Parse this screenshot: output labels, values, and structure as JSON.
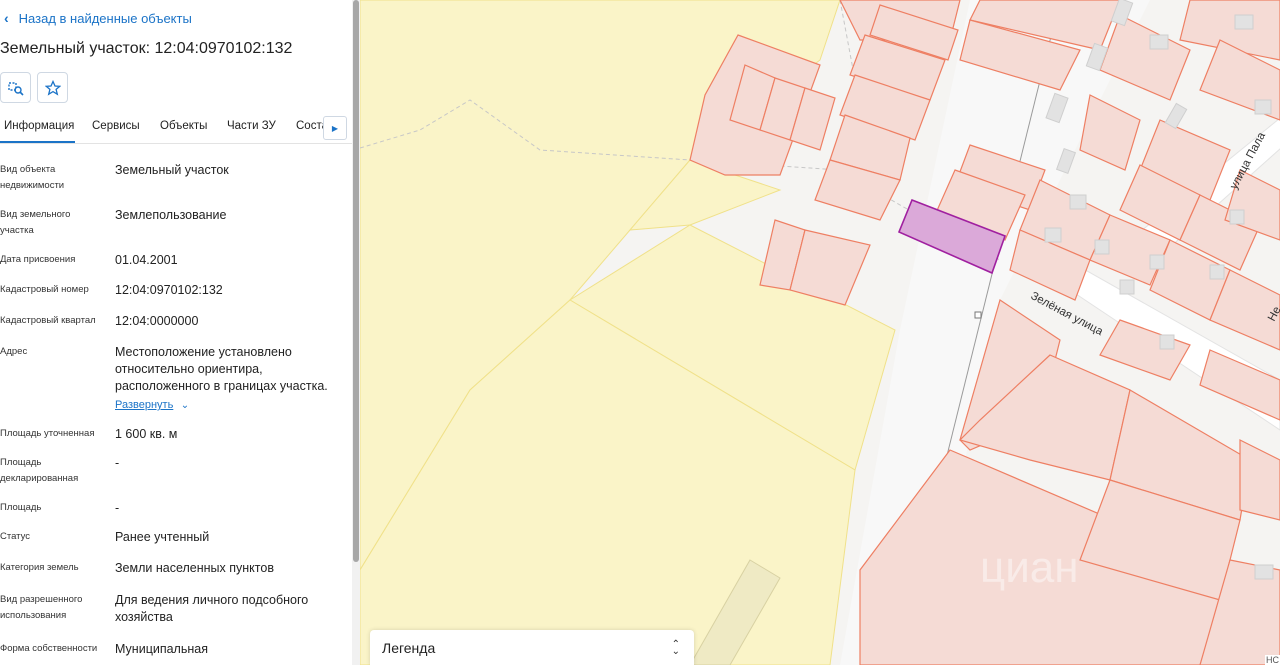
{
  "panel": {
    "back_label": "Назад в найденные объекты",
    "title": "Земельный участок: 12:04:0970102:132",
    "tabs": [
      "Информация",
      "Сервисы",
      "Объекты",
      "Части ЗУ",
      "Соста"
    ],
    "fields": [
      {
        "label": "Вид объекта недвижимости",
        "value": "Земельный участок"
      },
      {
        "label": "Вид земельного участка",
        "value": "Землепользование"
      },
      {
        "label": "Дата присвоения",
        "value": "01.04.2001"
      },
      {
        "label": "Кадастровый номер",
        "value": "12:04:0970102:132"
      },
      {
        "label": "Кадастровый квартал",
        "value": "12:04:0000000"
      },
      {
        "label": "Адрес",
        "value": "Местоположение установлено относительно ориентира, расположенного в границах участка.",
        "link": "Развернуть"
      },
      {
        "label": "Площадь уточненная",
        "value": "1 600 кв. м"
      },
      {
        "label": "Площадь декларированная",
        "value": "-"
      },
      {
        "label": "Площадь",
        "value": "-"
      },
      {
        "label": "Статус",
        "value": "Ранее учтенный"
      },
      {
        "label": "Категория земель",
        "value": "Земли населенных пунктов"
      },
      {
        "label": "Вид разрешенного использования",
        "value": "Для ведения личного подсобного хозяйства"
      },
      {
        "label": "Форма собственности",
        "value": "Муниципальная"
      }
    ]
  },
  "map": {
    "streets": [
      "Зелёная улица",
      "улица Пала",
      "Не"
    ],
    "watermark": "циан"
  },
  "legend": {
    "label": "Легенда"
  },
  "corner_text": "НС",
  "colors": {
    "accent": "#1b73c7",
    "parcel_fill": "#f5dbd5",
    "parcel_stroke": "#ee7f63",
    "selected_fill": "#dba9d9",
    "selected_stroke": "#a020a0",
    "zone_fill": "#faf4c8"
  }
}
